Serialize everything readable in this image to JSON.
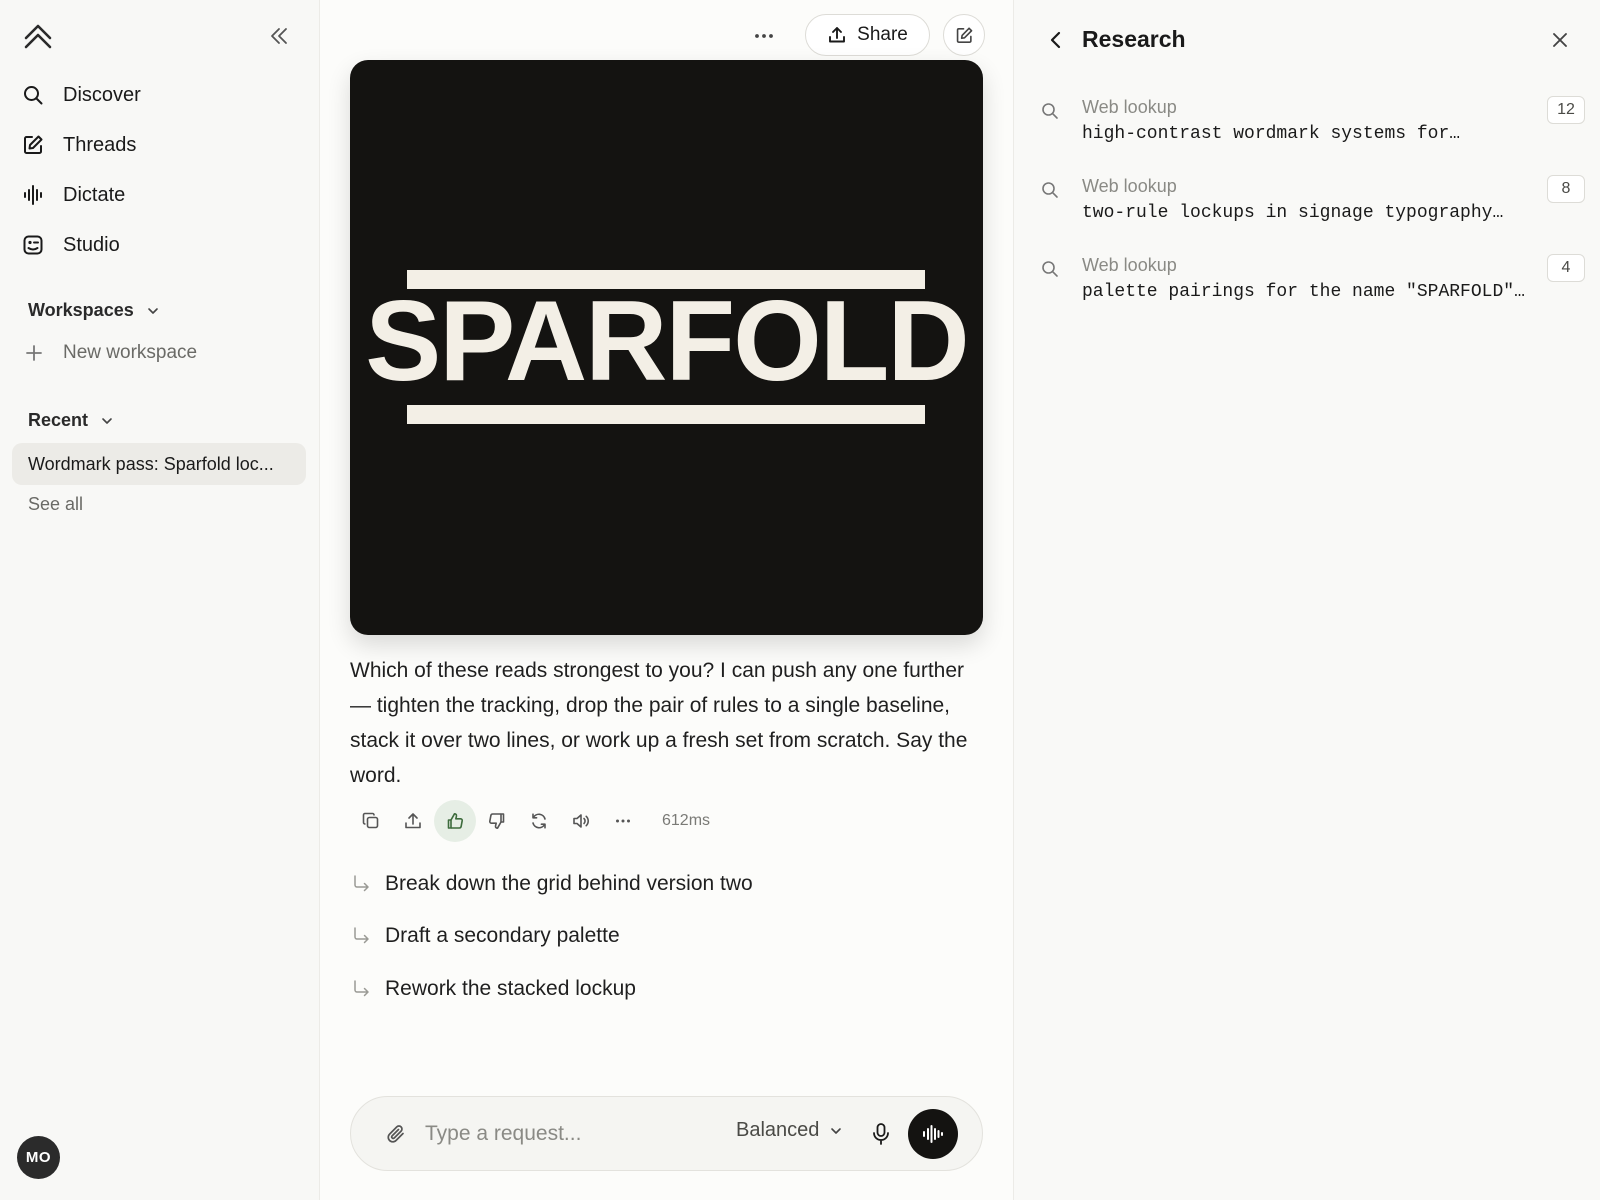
{
  "sidebar": {
    "nav": [
      {
        "label": "Discover",
        "icon": "search-icon"
      },
      {
        "label": "Threads",
        "icon": "edit-icon"
      },
      {
        "label": "Dictate",
        "icon": "waveform-icon"
      },
      {
        "label": "Studio",
        "icon": "studio-icon"
      }
    ],
    "workspaces_label": "Workspaces",
    "new_workspace_label": "New workspace",
    "recent_label": "Recent",
    "recent_items": [
      "Wordmark pass: Sparfold loc..."
    ],
    "see_all_label": "See all",
    "avatar_initials": "MO"
  },
  "header": {
    "share_label": "Share"
  },
  "artwork": {
    "wordmark": "SPARFOLD",
    "background_color": "#141311",
    "ink_color": "#f3efe6"
  },
  "message": {
    "text": "Which of these reads strongest to you? I can push any one further — tighten the tracking, drop the pair of rules to a single baseline, stack it over two lines, or work up a fresh set from scratch. Say the word.",
    "response_time": "612ms",
    "actions": [
      "copy-icon",
      "share-icon",
      "thumbs-up-icon",
      "thumbs-down-icon",
      "regenerate-icon",
      "speaker-icon",
      "more-icon"
    ],
    "liked": true
  },
  "suggestions": [
    "Break down the grid behind version two",
    "Draft a secondary palette",
    "Rework the stacked lockup"
  ],
  "composer": {
    "placeholder": "Type a request...",
    "mode": "Balanced"
  },
  "research_panel": {
    "title": "Research",
    "lookups": [
      {
        "kind": "Web lookup",
        "query": "high-contrast wordmark systems for…",
        "count": "12"
      },
      {
        "kind": "Web lookup",
        "query": "two-rule lockups in signage typography…",
        "count": "8"
      },
      {
        "kind": "Web lookup",
        "query": "palette pairings for the name \"SPARFOLD\"…",
        "count": "4"
      }
    ]
  },
  "colors": {
    "accent_like_bg": "#e6eee5",
    "dark": "#141311"
  }
}
